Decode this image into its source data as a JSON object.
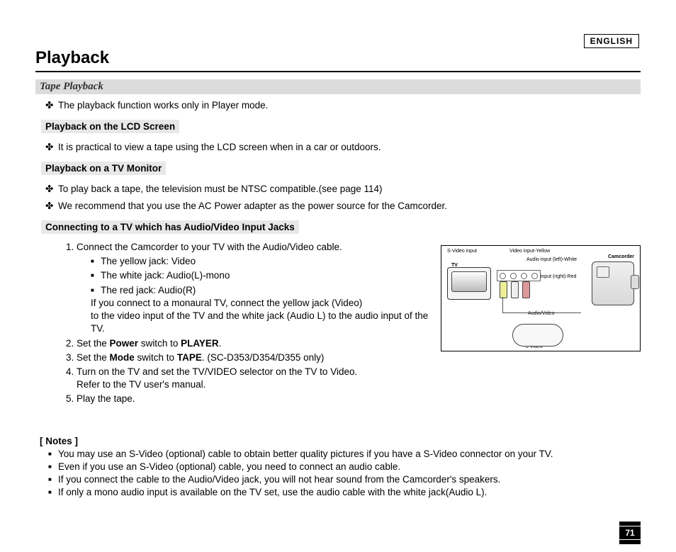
{
  "lang": "ENGLISH",
  "title": "Playback",
  "subtitle": "Tape Playback",
  "intro": "The playback function works only in Player mode.",
  "sec1": {
    "head": "Playback on the LCD Screen",
    "line": "It is practical to view a tape using the LCD screen when in a car or outdoors."
  },
  "sec2": {
    "head": "Playback on a TV Monitor",
    "line1": "To play back a tape, the television must be NTSC compatible.(see page 114)",
    "line2": "We recommend that you use the AC Power adapter as the power source for the Camcorder."
  },
  "sec3": {
    "head": "Connecting to a TV which has Audio/Video Input Jacks",
    "step1": "Connect the Camcorder to your TV with the Audio/Video cable.",
    "jack_y": "The yellow jack: Video",
    "jack_w": "The white jack: Audio(L)-mono",
    "jack_r": "The red jack: Audio(R)",
    "jack_note1": "If you connect to a monaural TV, connect the yellow jack (Video)",
    "jack_note2": "to the video input of the TV and the white jack (Audio L) to the audio input of the TV.",
    "step2_a": "Set the ",
    "step2_b": "Power",
    "step2_c": " switch to ",
    "step2_d": "PLAYER",
    "step2_e": ".",
    "step3_a": "Set the ",
    "step3_b": "Mode",
    "step3_c": " switch to ",
    "step3_d": "TAPE",
    "step3_e": ". (SC-D353/D354/D355 only)",
    "step4a": "Turn on the TV and set the TV/VIDEO selector on the TV to Video.",
    "step4b": "Refer to the TV user's manual.",
    "step5": "Play the tape."
  },
  "notes_head": "[ Notes ]",
  "notes": {
    "n1": "You may use an S-Video (optional) cable to obtain better quality pictures if you have a S-Video connector on your TV.",
    "n2": "Even if you use an S-Video (optional) cable, you need to connect an audio cable.",
    "n3": "If you connect the cable to the Audio/Video jack, you will not hear sound from the Camcorder's speakers.",
    "n4": "If only a mono audio input is available on the TV set, use the audio cable with the white jack(Audio L)."
  },
  "diagram": {
    "svideo_in": "S-Video input",
    "video_in": "Video input-Yellow",
    "audio_l": "Audio input (left)-White",
    "audio_r": "Audio input (right)-Red",
    "tv": "TV",
    "cam": "Camcorder",
    "av": "Audio/Video",
    "svideo": "S-Video"
  },
  "page_no": "71"
}
